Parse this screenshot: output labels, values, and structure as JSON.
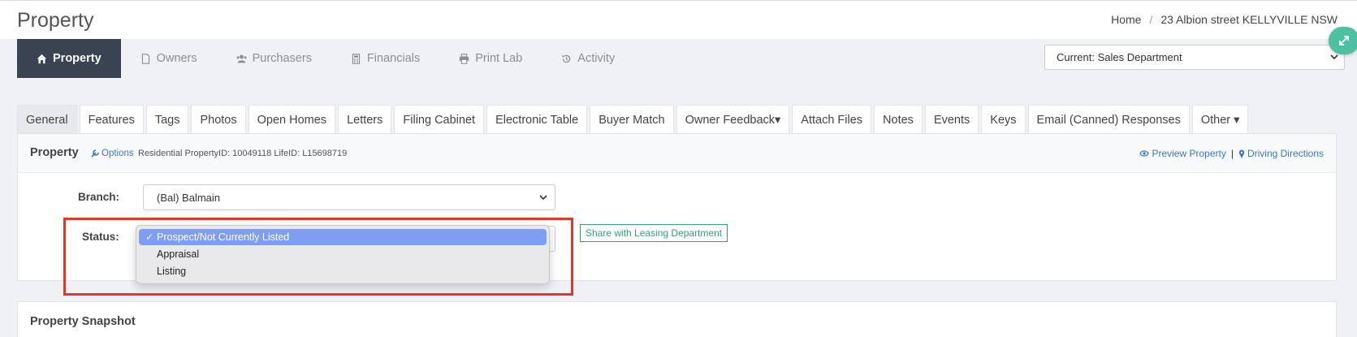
{
  "header": {
    "title": "Property",
    "breadcrumb": [
      "Home",
      "23 Albion street KELLYVILLE NSW"
    ],
    "breadcrumb_sep": "/"
  },
  "top_nav": [
    {
      "label": "Property",
      "icon": "home-icon",
      "active": true
    },
    {
      "label": "Owners",
      "icon": "file-icon",
      "active": false
    },
    {
      "label": "Purchasers",
      "icon": "users-icon",
      "active": false
    },
    {
      "label": "Financials",
      "icon": "calculator-icon",
      "active": false
    },
    {
      "label": "Print Lab",
      "icon": "printer-icon",
      "active": false
    },
    {
      "label": "Activity",
      "icon": "history-icon",
      "active": false
    }
  ],
  "department_select": {
    "value": "Current: Sales Department"
  },
  "sub_tabs": [
    {
      "label": "General",
      "active": true
    },
    {
      "label": "Features"
    },
    {
      "label": "Tags"
    },
    {
      "label": "Photos"
    },
    {
      "label": "Open Homes"
    },
    {
      "label": "Letters"
    },
    {
      "label": "Filing Cabinet"
    },
    {
      "label": "Electronic Table"
    },
    {
      "label": "Buyer Match"
    },
    {
      "label": "Owner Feedback▾"
    },
    {
      "label": "Attach Files"
    },
    {
      "label": "Notes"
    },
    {
      "label": "Events"
    },
    {
      "label": "Keys"
    },
    {
      "label": "Email (Canned) Responses"
    },
    {
      "label": "Other ▾"
    }
  ],
  "panel": {
    "title": "Property",
    "options_label": "Options",
    "ids_text": "Residential PropertyID: 10049118 LifeID: L15698719",
    "preview_label": "Preview Property",
    "divider": "|",
    "directions_label": "Driving Directions"
  },
  "form": {
    "branch_label": "Branch:",
    "branch_value": "(Bal) Balmain",
    "status_label": "Status:",
    "share_label": "Share with Leasing Department"
  },
  "status_dropdown": {
    "check": "✓",
    "options": [
      {
        "label": "Prospect/Not Currently Listed",
        "selected": true
      },
      {
        "label": "Appraisal",
        "selected": false
      },
      {
        "label": "Listing",
        "selected": false
      }
    ]
  },
  "snapshot": {
    "title": "Property Snapshot"
  },
  "colors": {
    "active_nav_bg": "#3a4352",
    "link": "#3a78c2",
    "accent_green": "#2fa27a",
    "highlight_red": "#e2382b",
    "dropdown_selected": "#7d9ef2"
  }
}
